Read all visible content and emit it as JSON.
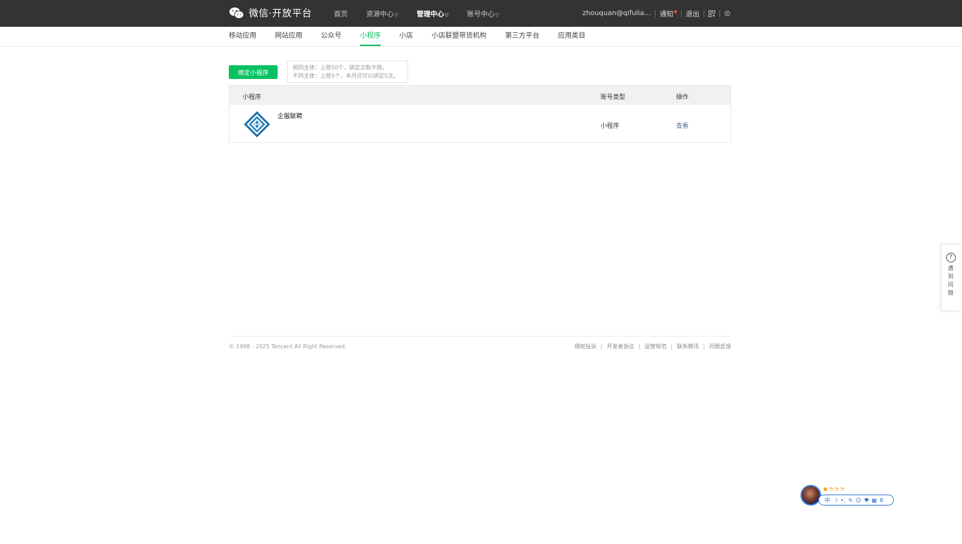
{
  "header": {
    "logo_text": "微信·开放平台",
    "nav": [
      {
        "label": "首页",
        "active": false,
        "has_dropdown": false
      },
      {
        "label": "资源中心",
        "active": false,
        "has_dropdown": true
      },
      {
        "label": "管理中心",
        "active": true,
        "has_dropdown": true
      },
      {
        "label": "账号中心",
        "active": false,
        "has_dropdown": true
      }
    ],
    "user": "zhouquan@qifulia...",
    "notice": "通知",
    "logout": "退出",
    "icons": [
      "qrcode-icon",
      "settings-icon"
    ]
  },
  "subnav": {
    "items": [
      {
        "label": "移动应用",
        "active": false
      },
      {
        "label": "网站应用",
        "active": false
      },
      {
        "label": "公众号",
        "active": false
      },
      {
        "label": "小程序",
        "active": true
      },
      {
        "label": "小店",
        "active": false
      },
      {
        "label": "小店联盟带货机构",
        "active": false
      },
      {
        "label": "第三方平台",
        "active": false
      },
      {
        "label": "应用类目",
        "active": false
      }
    ]
  },
  "main": {
    "bind_button": "绑定小程序",
    "tip_line1": "相同主体：上限50个，绑定次数不限。",
    "tip_line2": "不同主体：上限5个，本月还可以绑定5次。",
    "table": {
      "col_name": "小程序",
      "col_type": "账号类型",
      "col_action": "操作",
      "rows": [
        {
          "name": "企服联聘",
          "type": "小程序",
          "action": "查看"
        }
      ]
    }
  },
  "footer": {
    "copyright": "© 1998 - 2025 Tencent All Right Reserved.",
    "links": [
      "侵权投诉",
      "开发者协议",
      "运营规范",
      "联系腾讯",
      "问题反馈"
    ]
  },
  "help": {
    "label": "遇到问题"
  },
  "ime": {
    "chars": [
      "中",
      "☽",
      "•,",
      "✎",
      "☺",
      "♥",
      "▦",
      "8"
    ]
  },
  "colors": {
    "topbar": "#333333",
    "accent": "#07c160",
    "link": "#576b95"
  }
}
